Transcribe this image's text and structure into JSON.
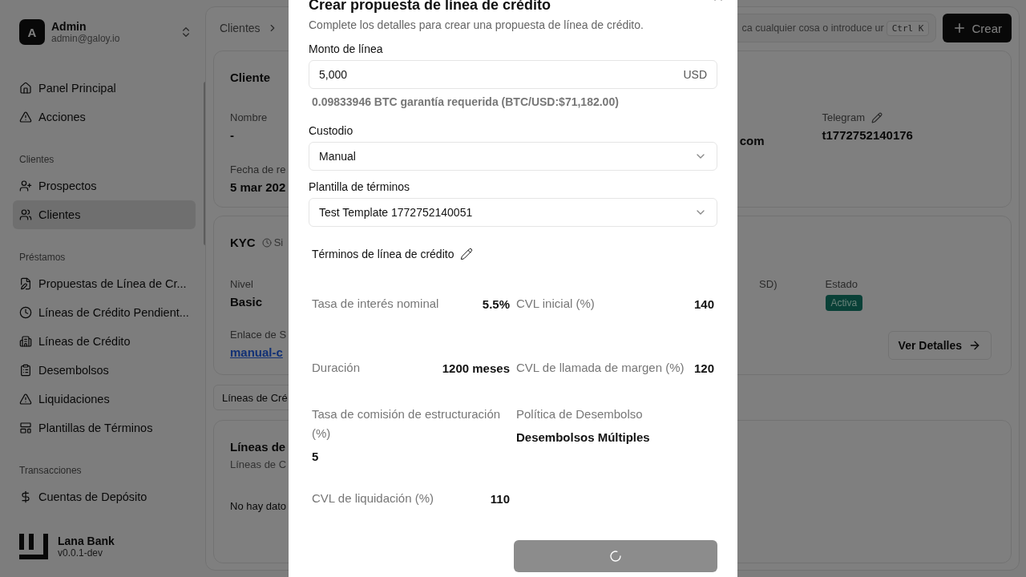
{
  "sidebar": {
    "user": {
      "avatar": "A",
      "name": "Admin",
      "email": "admin@galoy.io"
    },
    "groups": [
      {
        "items": [
          {
            "label": "Panel Principal",
            "selected": false
          },
          {
            "label": "Acciones",
            "selected": false
          }
        ]
      },
      {
        "title": "Clientes",
        "items": [
          {
            "label": "Prospectos",
            "selected": false
          },
          {
            "label": "Clientes",
            "selected": true
          }
        ]
      },
      {
        "title": "Préstamos",
        "items": [
          {
            "label": "Propuestas de Línea de Cr...",
            "selected": false
          },
          {
            "label": "Líneas de Crédito Pendient...",
            "selected": false
          },
          {
            "label": "Líneas de Crédito",
            "selected": false
          },
          {
            "label": "Desembolsos",
            "selected": false
          },
          {
            "label": "Liquidaciones",
            "selected": false
          },
          {
            "label": "Plantillas de Términos",
            "selected": false
          }
        ]
      },
      {
        "title": "Transacciones",
        "items": [
          {
            "label": "Cuentas de Depósito",
            "selected": false
          }
        ]
      }
    ],
    "brand": {
      "name": "Lana Bank",
      "version": "v0.0.1-dev"
    }
  },
  "header": {
    "breadcrumb": "Clientes",
    "search": {
      "placeholder": "ca cualquier cosa o introduce ur",
      "shortcut": "Ctrl K"
    },
    "create_button": "Crear"
  },
  "client_card": {
    "title": "Cliente",
    "fields": [
      {
        "label": "Nombre",
        "value": "-"
      },
      {
        "label": "Fecha de re",
        "value": "5 mar 202"
      }
    ],
    "email_value": "com",
    "telegram": {
      "label": "Telegram",
      "value": "t1772752140176"
    }
  },
  "kyc_card": {
    "title": "KYC",
    "status": "Si",
    "fields": [
      {
        "label": "Nivel",
        "value": "Basic"
      }
    ],
    "link": {
      "label": "Enlace de S",
      "value": "manual-c"
    },
    "amount_label": "SD)",
    "state": {
      "label": "Estado",
      "badge": "Activa"
    },
    "details_button": "Ver Detalles"
  },
  "tabs": [
    {
      "label": "Líneas de Cré",
      "selected": true
    }
  ],
  "facilities_card": {
    "title": "Líneas de",
    "subtitle": "Líneas de C",
    "empty": "No hay dato"
  },
  "dialog": {
    "title": "Crear propuesta de línea de crédito",
    "description": "Complete los detalles para crear una propuesta de línea de crédito.",
    "amount": {
      "label": "Monto de línea",
      "value": "5,000",
      "currency": "USD"
    },
    "collateral_note": "0.09833946 BTC garantía requerida (BTC/USD:$71,182.00)",
    "custodian": {
      "label": "Custodio",
      "value": "Manual"
    },
    "template": {
      "label": "Plantilla de términos",
      "value": "Test Template 1772752140051"
    },
    "terms": {
      "title": "Términos de línea de crédito",
      "items": [
        {
          "kind": "inline",
          "label": "Tasa de interés nominal",
          "value": "5.5%"
        },
        {
          "kind": "inline",
          "label": "CVL inicial (%)",
          "value": "140"
        },
        {
          "kind": "inline",
          "label": "Duración",
          "value": "1200 meses"
        },
        {
          "kind": "inline",
          "label": "CVL de llamada de margen (%)",
          "value": "120"
        },
        {
          "kind": "stacked",
          "label": "Tasa de comisión de estructuración (%)",
          "value": "5"
        },
        {
          "kind": "stacked",
          "label": "Política de Desembolso",
          "value": "Desembolsos Múltiples"
        },
        {
          "kind": "inline",
          "label": "CVL de liquidación (%)",
          "value": "110"
        }
      ]
    },
    "submit": {
      "loading": true
    }
  }
}
